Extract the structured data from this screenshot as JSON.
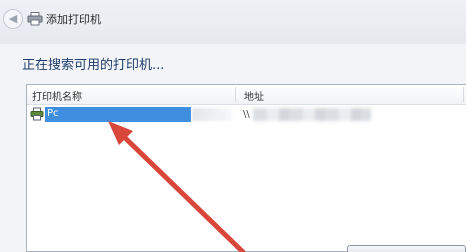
{
  "window": {
    "title": "添加打印机",
    "back_icon": "back-arrow-icon",
    "title_icon": "printer-icon"
  },
  "main": {
    "heading": "正在搜索可用的打印机..."
  },
  "list": {
    "columns": [
      "打印机名称",
      "地址"
    ],
    "rows": [
      {
        "name": "Pc",
        "address": "\\\\",
        "icon": "printer-icon",
        "selected": true
      }
    ]
  },
  "colors": {
    "selection": "#3f8ee0",
    "heading": "#1f3c6b",
    "annotation_arrow": "#d9463a"
  }
}
